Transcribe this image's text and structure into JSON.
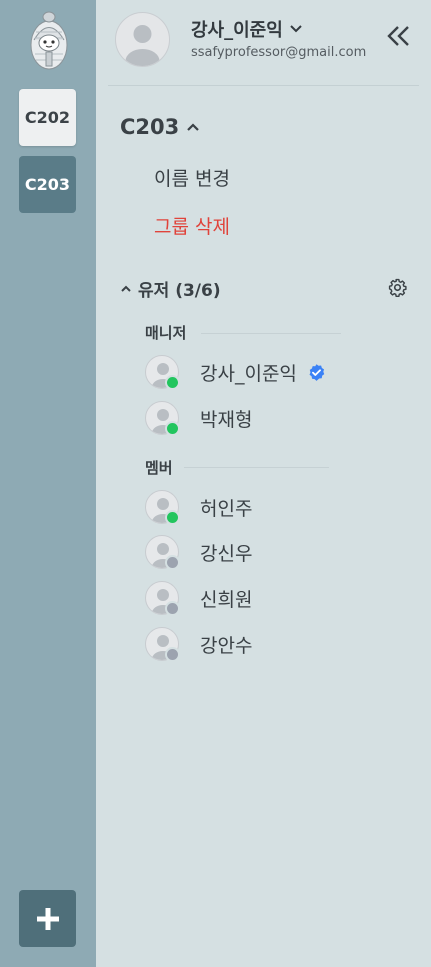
{
  "rail": {
    "groups": [
      {
        "label": "C202",
        "active": false
      },
      {
        "label": "C203",
        "active": true
      }
    ],
    "add_icon": "plus-icon"
  },
  "user": {
    "name": "강사_이준익",
    "email": "ssafyprofessor@gmail.com",
    "dropdown_icon": "chevron-down-icon",
    "collapse_icon": "double-chevron-left-icon"
  },
  "group": {
    "title": "C203",
    "toggle_icon": "chevron-up-icon",
    "menu": {
      "rename": "이름 변경",
      "delete": "그룹 삭제"
    }
  },
  "users": {
    "header": "유저 (3/6)",
    "settings_icon": "gear-icon",
    "managers_label": "매니저",
    "members_label": "멤버",
    "managers": [
      {
        "name": "강사_이준익",
        "online": true,
        "verified": true
      },
      {
        "name": "박재형",
        "online": true,
        "verified": false
      }
    ],
    "members": [
      {
        "name": "허인주",
        "online": true
      },
      {
        "name": "강신우",
        "online": false
      },
      {
        "name": "신희원",
        "online": false
      },
      {
        "name": "강안수",
        "online": false
      }
    ]
  },
  "colors": {
    "online": "#22c55e",
    "offline": "#9ca3af",
    "danger": "#e0433b",
    "verified": "#3b82f6",
    "rail": "#8eaab4",
    "panel": "#d5e0e2"
  }
}
